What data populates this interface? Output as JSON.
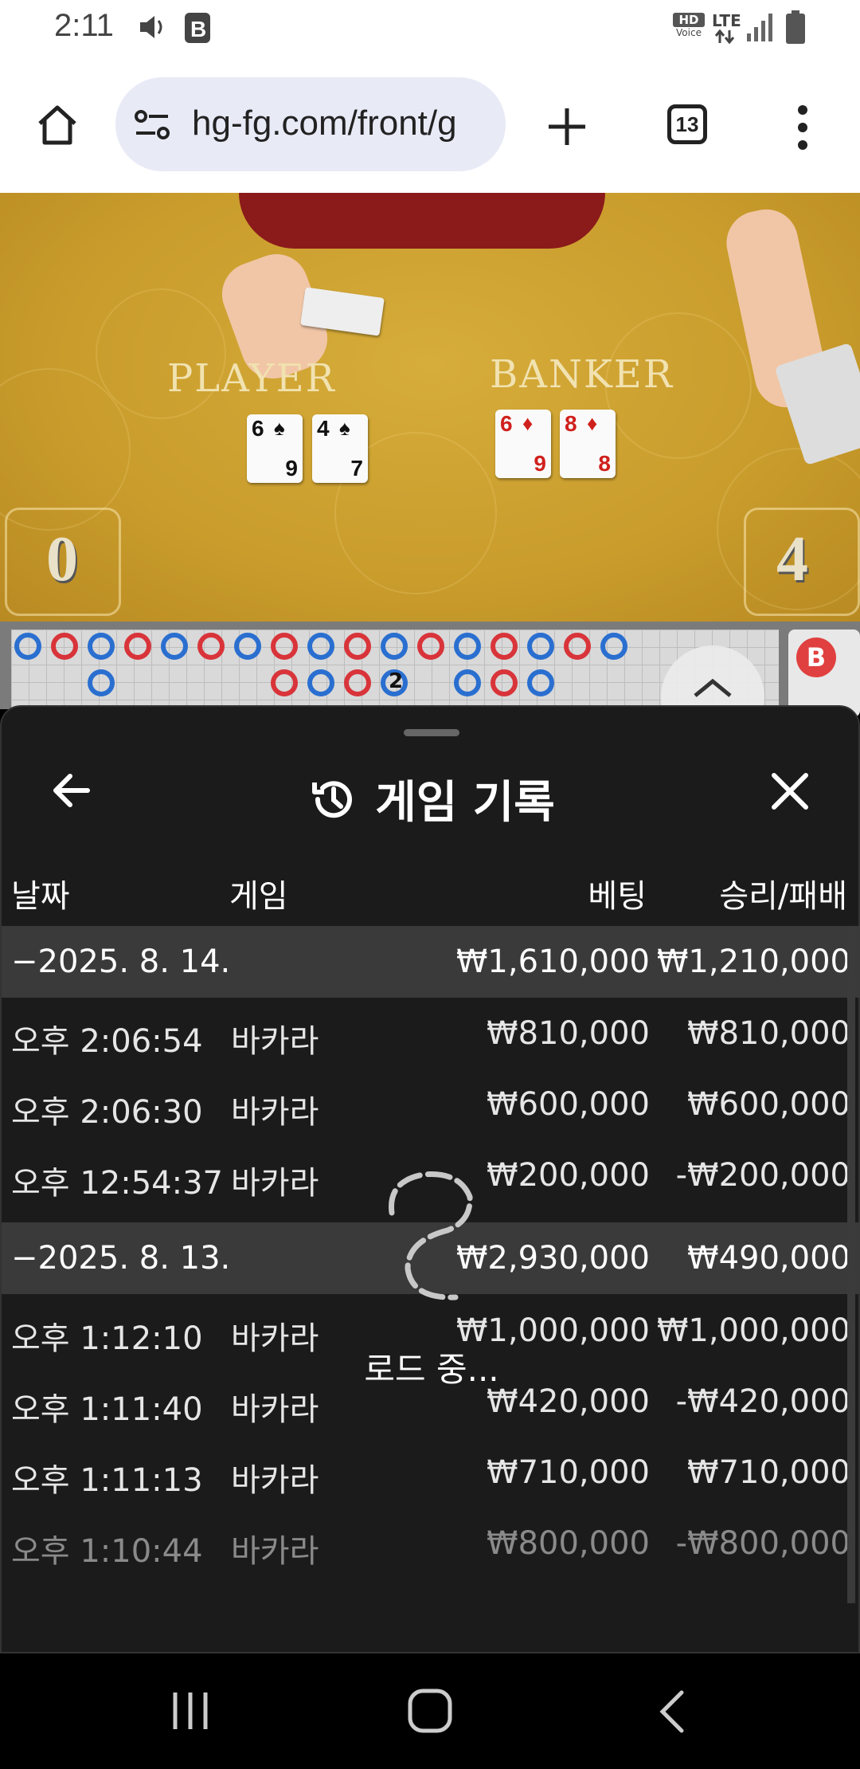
{
  "status_bar": {
    "time": "2:11",
    "hd_label": "HD",
    "voice_label": "Voice",
    "network": "LTE"
  },
  "browser": {
    "url": "hg-fg.com/front/g",
    "tab_count": "13"
  },
  "table": {
    "player_label": "PLAYER",
    "banker_label": "BANKER",
    "player_cards": [
      {
        "rank": "6",
        "suit": "♠",
        "bottom": "9",
        "color": "black"
      },
      {
        "rank": "4",
        "suit": "♠",
        "bottom": "7",
        "color": "black"
      }
    ],
    "banker_cards": [
      {
        "rank": "6",
        "suit": "♦",
        "bottom": "9",
        "color": "red"
      },
      {
        "rank": "8",
        "suit": "♦",
        "bottom": "8",
        "color": "red"
      }
    ],
    "player_score": "0",
    "banker_score": "4"
  },
  "roadmap": {
    "tie_count": "2",
    "side_label": "B"
  },
  "panel": {
    "title": "게임 기록",
    "headers": {
      "date": "날짜",
      "game": "게임",
      "bet": "베팅",
      "winloss": "승리/패배"
    },
    "rows": [
      {
        "type": "date",
        "date": "−2025. 8. 14.",
        "game": "",
        "bet": "₩1,610,000",
        "result": "₩1,210,000"
      },
      {
        "type": "item",
        "date": "오후 2:06:54",
        "game": "바카라",
        "bet": "₩810,000",
        "result": "₩810,000"
      },
      {
        "type": "item",
        "date": "오후 2:06:30",
        "game": "바카라",
        "bet": "₩600,000",
        "result": "₩600,000"
      },
      {
        "type": "item",
        "date": "오후 12:54:37",
        "game": "바카라",
        "bet": "₩200,000",
        "result": "-₩200,000"
      },
      {
        "type": "date",
        "date": "−2025. 8. 13.",
        "game": "",
        "bet": "₩2,930,000",
        "result": "₩490,000"
      },
      {
        "type": "item",
        "date": "오후 1:12:10",
        "game": "바카라",
        "bet": "₩1,000,000",
        "result": "₩1,000,000"
      },
      {
        "type": "item",
        "date": "오후 1:11:40",
        "game": "바카라",
        "bet": "₩420,000",
        "result": "-₩420,000"
      },
      {
        "type": "item",
        "date": "오후 1:11:13",
        "game": "바카라",
        "bet": "₩710,000",
        "result": "₩710,000"
      },
      {
        "type": "item",
        "date": "오후 1:10:44",
        "game": "바카라",
        "bet": "₩800,000",
        "result": "-₩800,000"
      }
    ],
    "loading_text": "로드 중..."
  }
}
